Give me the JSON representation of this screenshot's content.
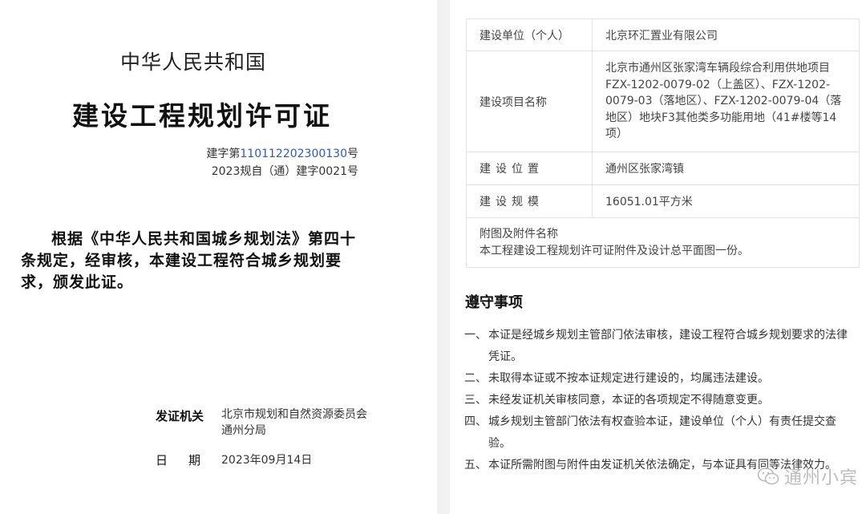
{
  "left": {
    "country": "中华人民共和国",
    "title": "建设工程规划许可证",
    "cert_no": {
      "prefix": "建字第",
      "number": "110112202300130",
      "suffix": "号",
      "line2": "2023规自（通）建字0021号"
    },
    "statement": "根据《中华人民共和国城乡规划法》第四十条规定，经审核，本建设工程符合城乡规划要求，颁发此证。",
    "issuer_label": "发证机关",
    "issuer_line1": "北京市规划和自然资源委员会",
    "issuer_line2": "通州分局",
    "date_label_1": "日",
    "date_label_2": "期",
    "date_value": "2023年09月14日"
  },
  "right": {
    "rows": [
      {
        "key": "建设单位（个人）",
        "value": "北京环汇置业有限公司"
      },
      {
        "key": "建设项目名称",
        "value_lines": [
          "北京市通州区张家湾车辆段综合利用供地项目",
          "FZX-1202-0079-02（上盖区）、FZX-1202-",
          "0079-03（落地区）、FZX-1202-0079-04（落",
          "地区）地块F3其他类多功能用地（41#楼等14",
          "项）"
        ]
      },
      {
        "key": "建设位置",
        "value": "通州区张家湾镇"
      },
      {
        "key": "建设规模",
        "value": "16051.01平方米"
      }
    ],
    "attachments_label": "附图及附件名称",
    "attachments_value": "本工程建设工程规划许可证附件及设计总平面图一份。",
    "rules_title": "遵守事项",
    "rules": [
      {
        "n": "一、",
        "text": "本证是经城乡规划主管部门依法审核，建设工程符合城乡规划要求的法律凭证。"
      },
      {
        "n": "二、",
        "text": "未取得本证或不按本证规定进行建设的，均属违法建设。"
      },
      {
        "n": "三、",
        "text": "未经发证机关审核同意，本证的各项规定不得随意变更。"
      },
      {
        "n": "四、",
        "text": "城乡规划主管部门依法有权查验本证，建设单位（个人）有责任提交查验。"
      },
      {
        "n": "五、",
        "text": "本证所需附图与附件由发证机关依法确定，与本证具有同等法律效力。"
      }
    ]
  },
  "watermark": {
    "text": "通州小宾",
    "icon": "wechat-icon"
  }
}
